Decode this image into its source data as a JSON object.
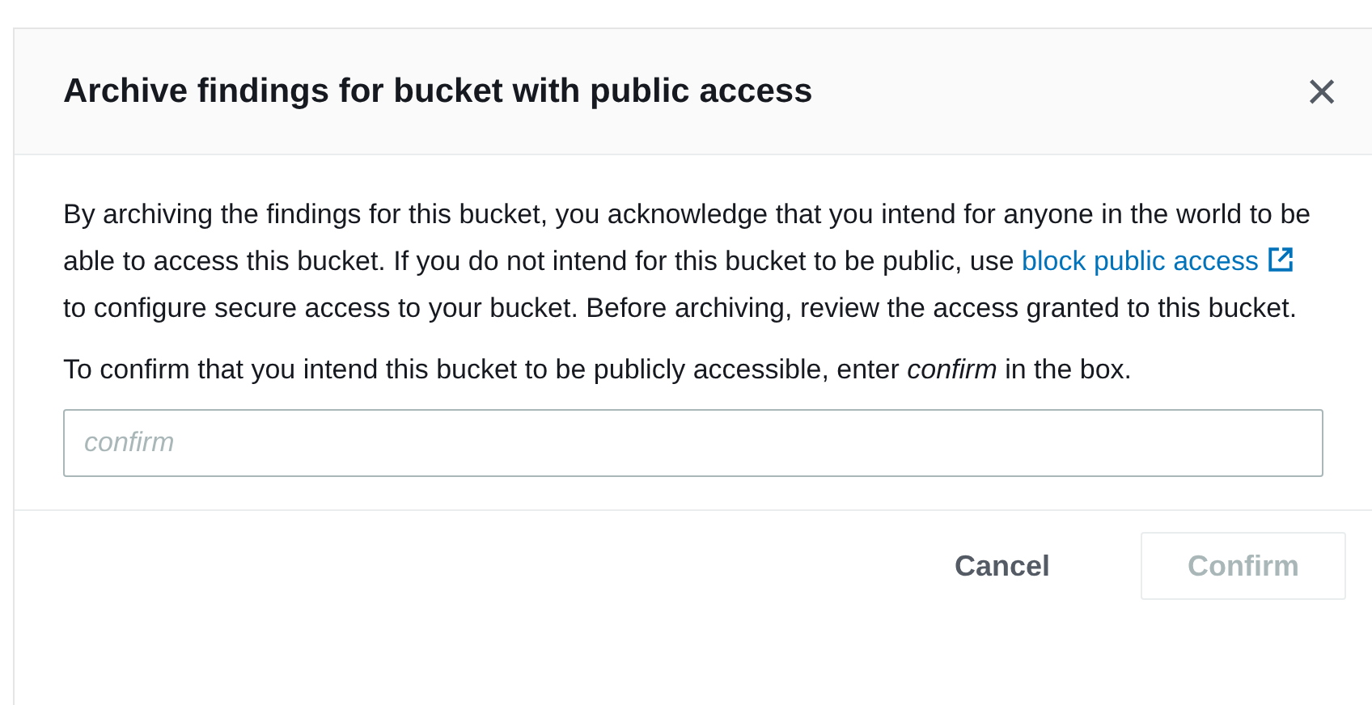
{
  "dialog": {
    "title": "Archive findings for bucket with public access",
    "close": "×",
    "message": {
      "before": "By archiving the findings for this bucket, you acknowledge that you intend for anyone in the world to be able to access this bucket. If you do not intend for this bucket to be public, use",
      "link": "block public access",
      "after": "to configure secure access to your bucket. Before archiving, review the access granted to this bucket."
    },
    "instruction": "To confirm that you intend this bucket to be publicly accessible, enter *confirm* in the box.",
    "input": {
      "placeholder": "confirm"
    },
    "buttons": [
      {
        "label": "Cancel",
        "kind": "link",
        "disabled": false
      },
      {
        "label": "Confirm",
        "kind": "primary",
        "disabled": true
      }
    ]
  }
}
